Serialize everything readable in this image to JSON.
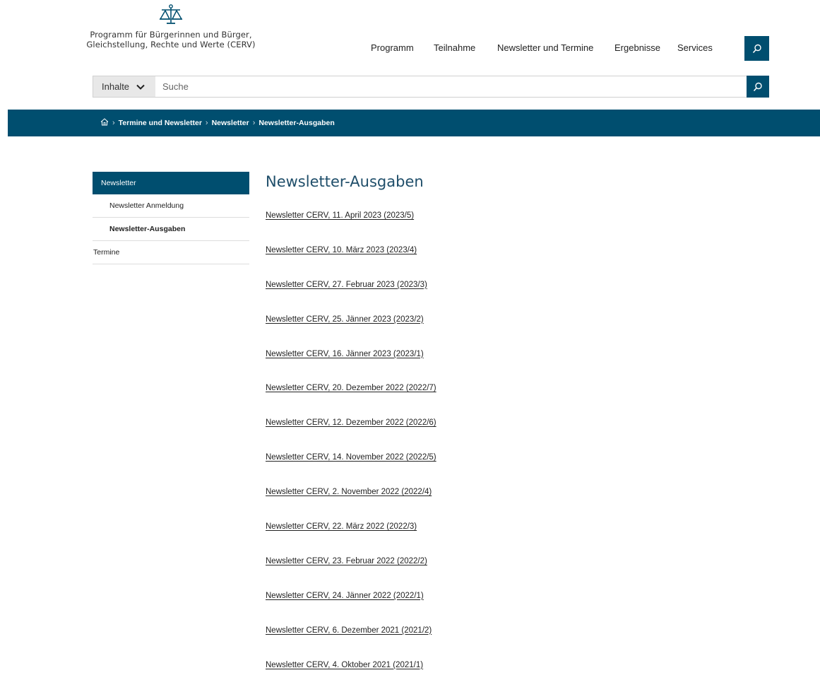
{
  "header": {
    "logo_line1": "Programm für Bürgerinnen und Bürger,",
    "logo_line2": "Gleichstellung, Rechte und Werte (CERV)",
    "logo_icon": "scales-of-justice-icon",
    "nav": {
      "programm": "Programm",
      "teilnahme": "Teilnahme",
      "newsletter_termine": "Newsletter und Termine",
      "ergebnisse": "Ergebnisse",
      "services": "Services"
    },
    "search_icon": "search-icon"
  },
  "search": {
    "scope_label": "Inhalte",
    "placeholder": "Suche"
  },
  "breadcrumb": {
    "home_icon": "home-icon",
    "item1": "Termine und Newsletter",
    "item2": "Newsletter",
    "current": "Newsletter-Ausgaben"
  },
  "sidebar": {
    "newsletter": "Newsletter",
    "anmeldung": "Newsletter Anmeldung",
    "ausgaben": "Newsletter-Ausgaben",
    "termine": "Termine"
  },
  "main": {
    "title": "Newsletter-Ausgaben",
    "issues": [
      "Newsletter CERV, 11. April 2023 (2023/5)",
      "Newsletter CERV, 10. März 2023 (2023/4)",
      "Newsletter CERV, 27. Februar 2023 (2023/3)",
      "Newsletter CERV, 25. Jänner 2023 (2023/2)",
      "Newsletter CERV, 16. Jänner 2023 (2023/1)",
      "Newsletter CERV, 20. Dezember 2022 (2022/7)",
      "Newsletter CERV, 12. Dezember 2022 (2022/6)",
      "Newsletter CERV, 14. November 2022 (2022/5)",
      "Newsletter CERV, 2. November 2022 (2022/4)",
      "Newsletter CERV, 22. März 2022 (2022/3)",
      "Newsletter CERV, 23. Februar 2022 (2022/2)",
      "Newsletter CERV, 24. Jänner 2022 (2022/1)",
      "Newsletter CERV, 6. Dezember 2021 (2021/2)",
      "Newsletter CERV, 4. Oktober 2021 (2021/1)"
    ]
  },
  "colors": {
    "brand": "#004e6f",
    "title": "#1f4e6a"
  }
}
